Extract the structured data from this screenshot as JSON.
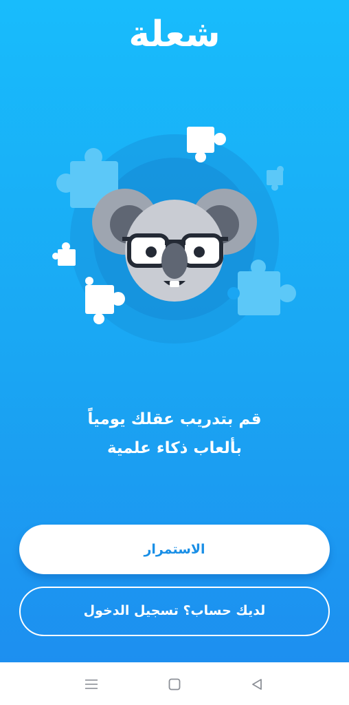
{
  "app": {
    "logo_text": "شعلة"
  },
  "onboarding": {
    "tagline_line1": "قم بتدريب عقلك يومياً",
    "tagline_line2": "بألعاب ذكاء علمية",
    "illustration": "koala-with-glasses-and-puzzle-pieces"
  },
  "actions": {
    "continue_label": "الاستمرار",
    "login_label": "لديك حساب؟ تسجيل الدخول"
  },
  "navbar": {
    "icons": [
      "menu-icon",
      "home-square-icon",
      "back-triangle-icon"
    ]
  },
  "colors": {
    "background_top": "#18bcfc",
    "background_bottom": "#1d8ff0",
    "primary_text_on_button": "#1a8fe6",
    "white": "#ffffff"
  }
}
